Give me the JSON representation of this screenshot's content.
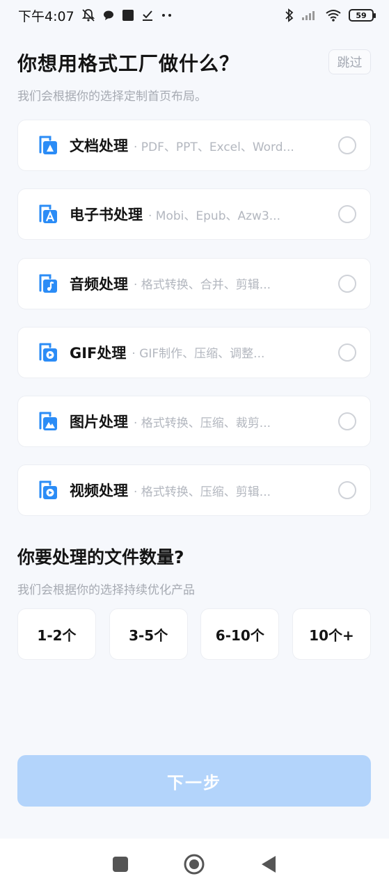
{
  "status_bar": {
    "time": "下午4:07",
    "battery": "59"
  },
  "header": {
    "title": "你想用格式工厂做什么？",
    "subtitle": "我们会根据你的选择定制首页布局。",
    "skip_label": "跳过"
  },
  "categories": [
    {
      "name": "文档处理",
      "desc": "· PDF、PPT、Excel、Word...",
      "icon": "document-icon"
    },
    {
      "name": "电子书处理",
      "desc": "· Mobi、Epub、Azw3...",
      "icon": "ebook-icon"
    },
    {
      "name": "音频处理",
      "desc": "· 格式转换、合并、剪辑...",
      "icon": "audio-icon"
    },
    {
      "name": "GIF处理",
      "desc": "· GIF制作、压缩、调整...",
      "icon": "gif-icon"
    },
    {
      "name": "图片处理",
      "desc": "· 格式转换、压缩、裁剪...",
      "icon": "image-icon"
    },
    {
      "name": "视频处理",
      "desc": "· 格式转换、压缩、剪辑...",
      "icon": "video-icon"
    }
  ],
  "file_count": {
    "title": "你要处理的文件数量?",
    "subtitle": "我们会根据你的选择持续优化产品",
    "options": [
      "1-2个",
      "3-5个",
      "6-10个",
      "10个+"
    ]
  },
  "next_label": "下一步",
  "colors": {
    "accent": "#2b8cf6",
    "next_disabled": "#b3d4fb",
    "background": "#f6f8fc"
  }
}
